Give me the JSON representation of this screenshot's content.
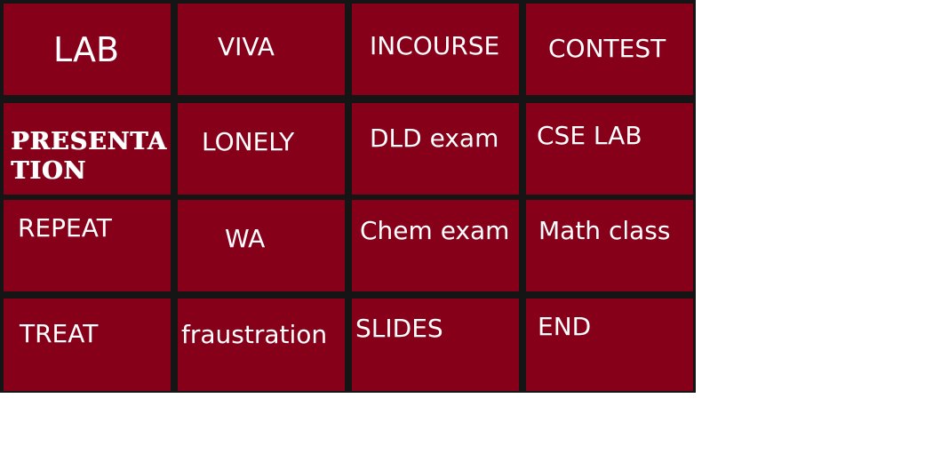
{
  "board": {
    "tile_color": "#86001a",
    "gap_color": "#151515",
    "text_color": "#ffffff",
    "rows": [
      [
        "LAB",
        "VIVA",
        "INCOURSE",
        "CONTEST"
      ],
      [
        "PRESENTA TION",
        "LONELY",
        "DLD exam",
        "CSE LAB"
      ],
      [
        "REPEAT",
        "WA",
        "Chem exam",
        "Math class"
      ],
      [
        "TREAT",
        "fraustration",
        "SLIDES",
        "END"
      ]
    ]
  }
}
